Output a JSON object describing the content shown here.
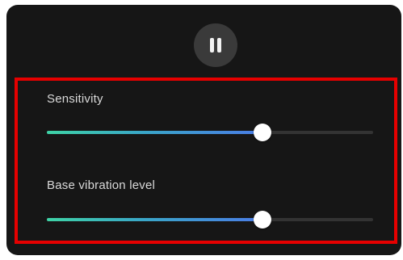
{
  "controls": {
    "pause_icon": "pause-icon"
  },
  "sliders": [
    {
      "label": "Sensitivity",
      "value": 0.66
    },
    {
      "label": "Base vibration level",
      "value": 0.66
    }
  ],
  "colors": {
    "panel_background": "#161616",
    "highlight_border": "#e60000",
    "slider_start": "#3ed3a6",
    "slider_end": "#4a7ce6",
    "track": "#333333"
  }
}
